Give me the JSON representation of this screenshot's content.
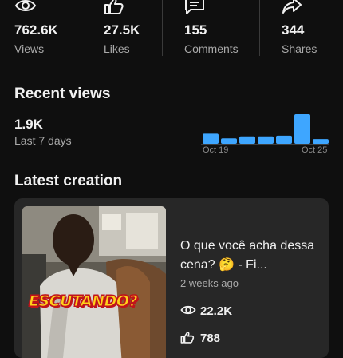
{
  "stats": [
    {
      "icon": "eye-icon",
      "value": "762.6K",
      "label": "Views"
    },
    {
      "icon": "thumbs-up-icon",
      "value": "27.5K",
      "label": "Likes"
    },
    {
      "icon": "comment-icon",
      "value": "155",
      "label": "Comments"
    },
    {
      "icon": "share-icon",
      "value": "344",
      "label": "Shares"
    }
  ],
  "recent_views": {
    "title": "Recent views",
    "value": "1.9K",
    "period": "Last 7 days",
    "chart_data": {
      "type": "bar",
      "color": "#3ea6ff",
      "values": [
        0.3,
        0.16,
        0.22,
        0.22,
        0.24,
        0.88,
        0.14
      ],
      "x_tick_labels": [
        "Oct 19",
        "Oct 25"
      ]
    }
  },
  "latest_creation": {
    "title": "Latest creation",
    "video": {
      "thumbnail_text": "ESCUTANDO?",
      "title": "O que você acha dessa cena? 🤔 - Fi...",
      "posted": "2 weeks ago",
      "views": "22.2K",
      "likes": "788"
    }
  }
}
